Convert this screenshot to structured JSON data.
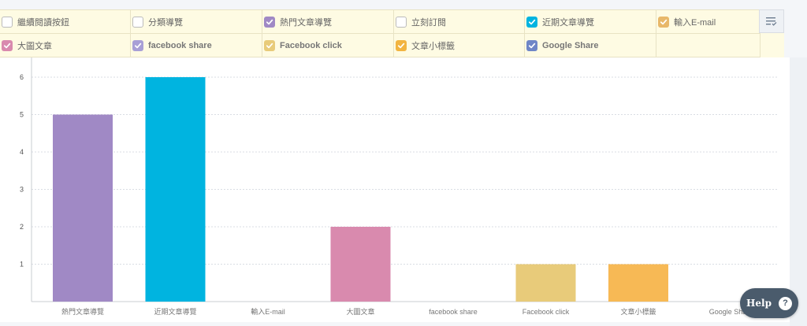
{
  "legend": {
    "items": [
      {
        "label": "繼續閱讀按鈕",
        "checked": false,
        "color": "#9e9e9e"
      },
      {
        "label": "分類導覽",
        "checked": false,
        "color": "#9e9e9e"
      },
      {
        "label": "熱門文章導覽",
        "checked": true,
        "color": "#a089c5"
      },
      {
        "label": "立刻訂閱",
        "checked": false,
        "color": "#9e9e9e"
      },
      {
        "label": "近期文章導覽",
        "checked": true,
        "color": "#00b4e0"
      },
      {
        "label": "輸入E-mail",
        "checked": true,
        "color": "#e8b86a"
      },
      {
        "label": "大圖文章",
        "checked": true,
        "color": "#d98aae"
      },
      {
        "label": "facebook share",
        "checked": true,
        "color": "#a89fd6"
      },
      {
        "label": "Facebook click",
        "checked": true,
        "color": "#e8cb7a"
      },
      {
        "label": "文章小標籤",
        "checked": true,
        "color": "#f2b441"
      },
      {
        "label": "Google Share",
        "checked": true,
        "color": "#6f86c7"
      }
    ],
    "menu_icon": "list-filter-icon"
  },
  "chart_data": {
    "type": "bar",
    "categories": [
      "熱門文章導覽",
      "近期文章導覽",
      "輸入E-mail",
      "大圖文章",
      "facebook share",
      "Facebook click",
      "文章小標籤",
      "Google Share"
    ],
    "values": [
      5,
      6,
      0,
      2,
      0,
      1,
      1,
      0
    ],
    "colors": [
      "#a089c5",
      "#00b4e0",
      "#e8b86a",
      "#d98aae",
      "#a89fd6",
      "#e8cb7a",
      "#f7b955",
      "#6f86c7"
    ],
    "ylim": [
      0,
      6.3
    ],
    "yticks": [
      1,
      2,
      3,
      4,
      5,
      6
    ],
    "grid": true,
    "legend": "top"
  },
  "help": {
    "label": "Help",
    "icon_glyph": "?"
  }
}
